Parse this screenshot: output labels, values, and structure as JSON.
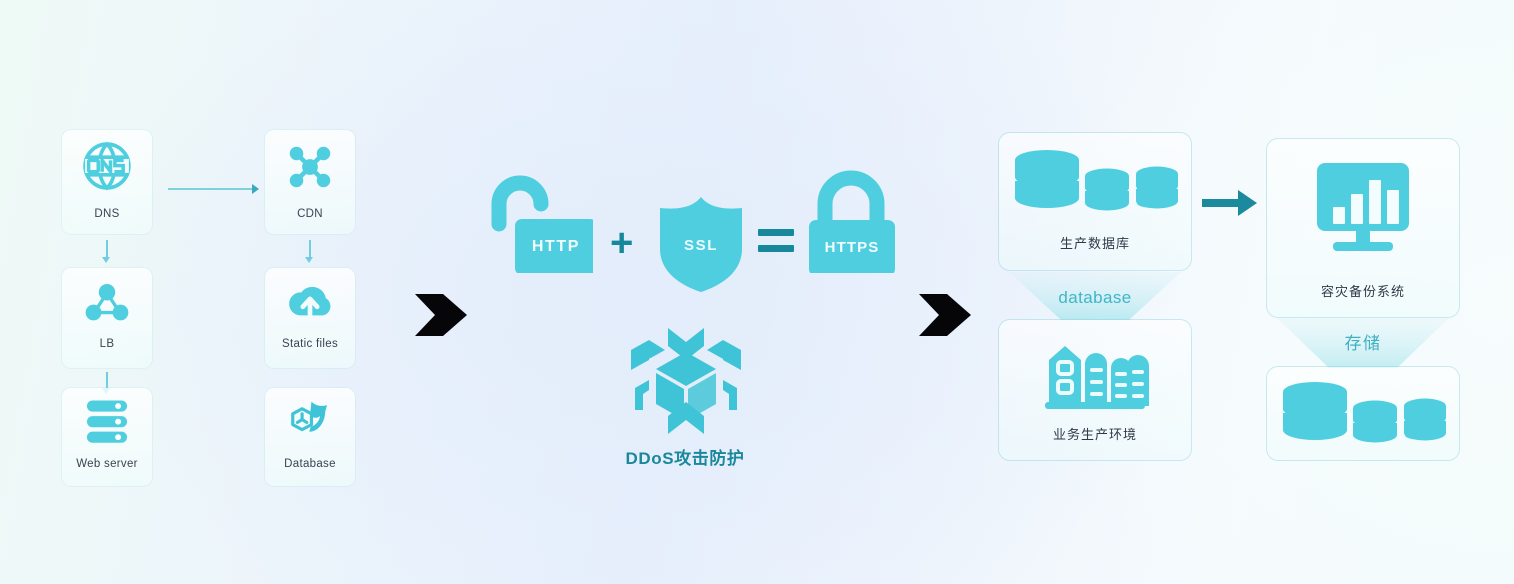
{
  "palette": {
    "cyan": "#4ecede",
    "cyan_deep": "#3ec4d6",
    "teal": "#17879c",
    "teal_arrow": "#1a8a9c",
    "chevron_black": "#060608",
    "label_text": "#3a4351",
    "bg_left": "#eefaf6",
    "bg_mid": "#e7effc",
    "bg_right": "#f2fbfb"
  },
  "left_stack": {
    "column_a": [
      {
        "label": "DNS",
        "icon": "dns-globe-icon"
      },
      {
        "label": "LB",
        "icon": "load-balancer-icon"
      },
      {
        "label": "Web server",
        "icon": "web-server-rack-icon"
      }
    ],
    "column_b": [
      {
        "label": "CDN",
        "icon": "cdn-network-icon"
      },
      {
        "label": "Static files",
        "icon": "cloud-upload-icon"
      },
      {
        "label": "Database",
        "icon": "mysql-dolphin-icon"
      }
    ]
  },
  "middle": {
    "chevron_left": "chevron-right-icon",
    "chevron_right": "chevron-right-icon",
    "equation": {
      "http_label": "HTTP",
      "plus_sign": "+",
      "ssl_label": "SSL",
      "equals_sign": "=",
      "https_label": "HTTPS",
      "unlocked_icon": "open-padlock-icon",
      "shield_icon": "shield-icon",
      "locked_icon": "closed-padlock-icon"
    },
    "ddos": {
      "icon": "ddos-cube-shield-icon",
      "label": "DDoS攻击防护"
    }
  },
  "right": {
    "column_c": {
      "top": {
        "label": "生产数据库",
        "icon": "database-cylinders-icon"
      },
      "connector": "database",
      "bottom": {
        "label": "业务生产环境",
        "icon": "buildings-icon"
      }
    },
    "column_d": {
      "top": {
        "label": "容灾备份系统",
        "icon": "monitor-chart-icon"
      },
      "connector": "存储",
      "bottom": {
        "label": "",
        "icon": "database-cylinders-icon"
      }
    },
    "arrow": "arrow-right-icon"
  }
}
